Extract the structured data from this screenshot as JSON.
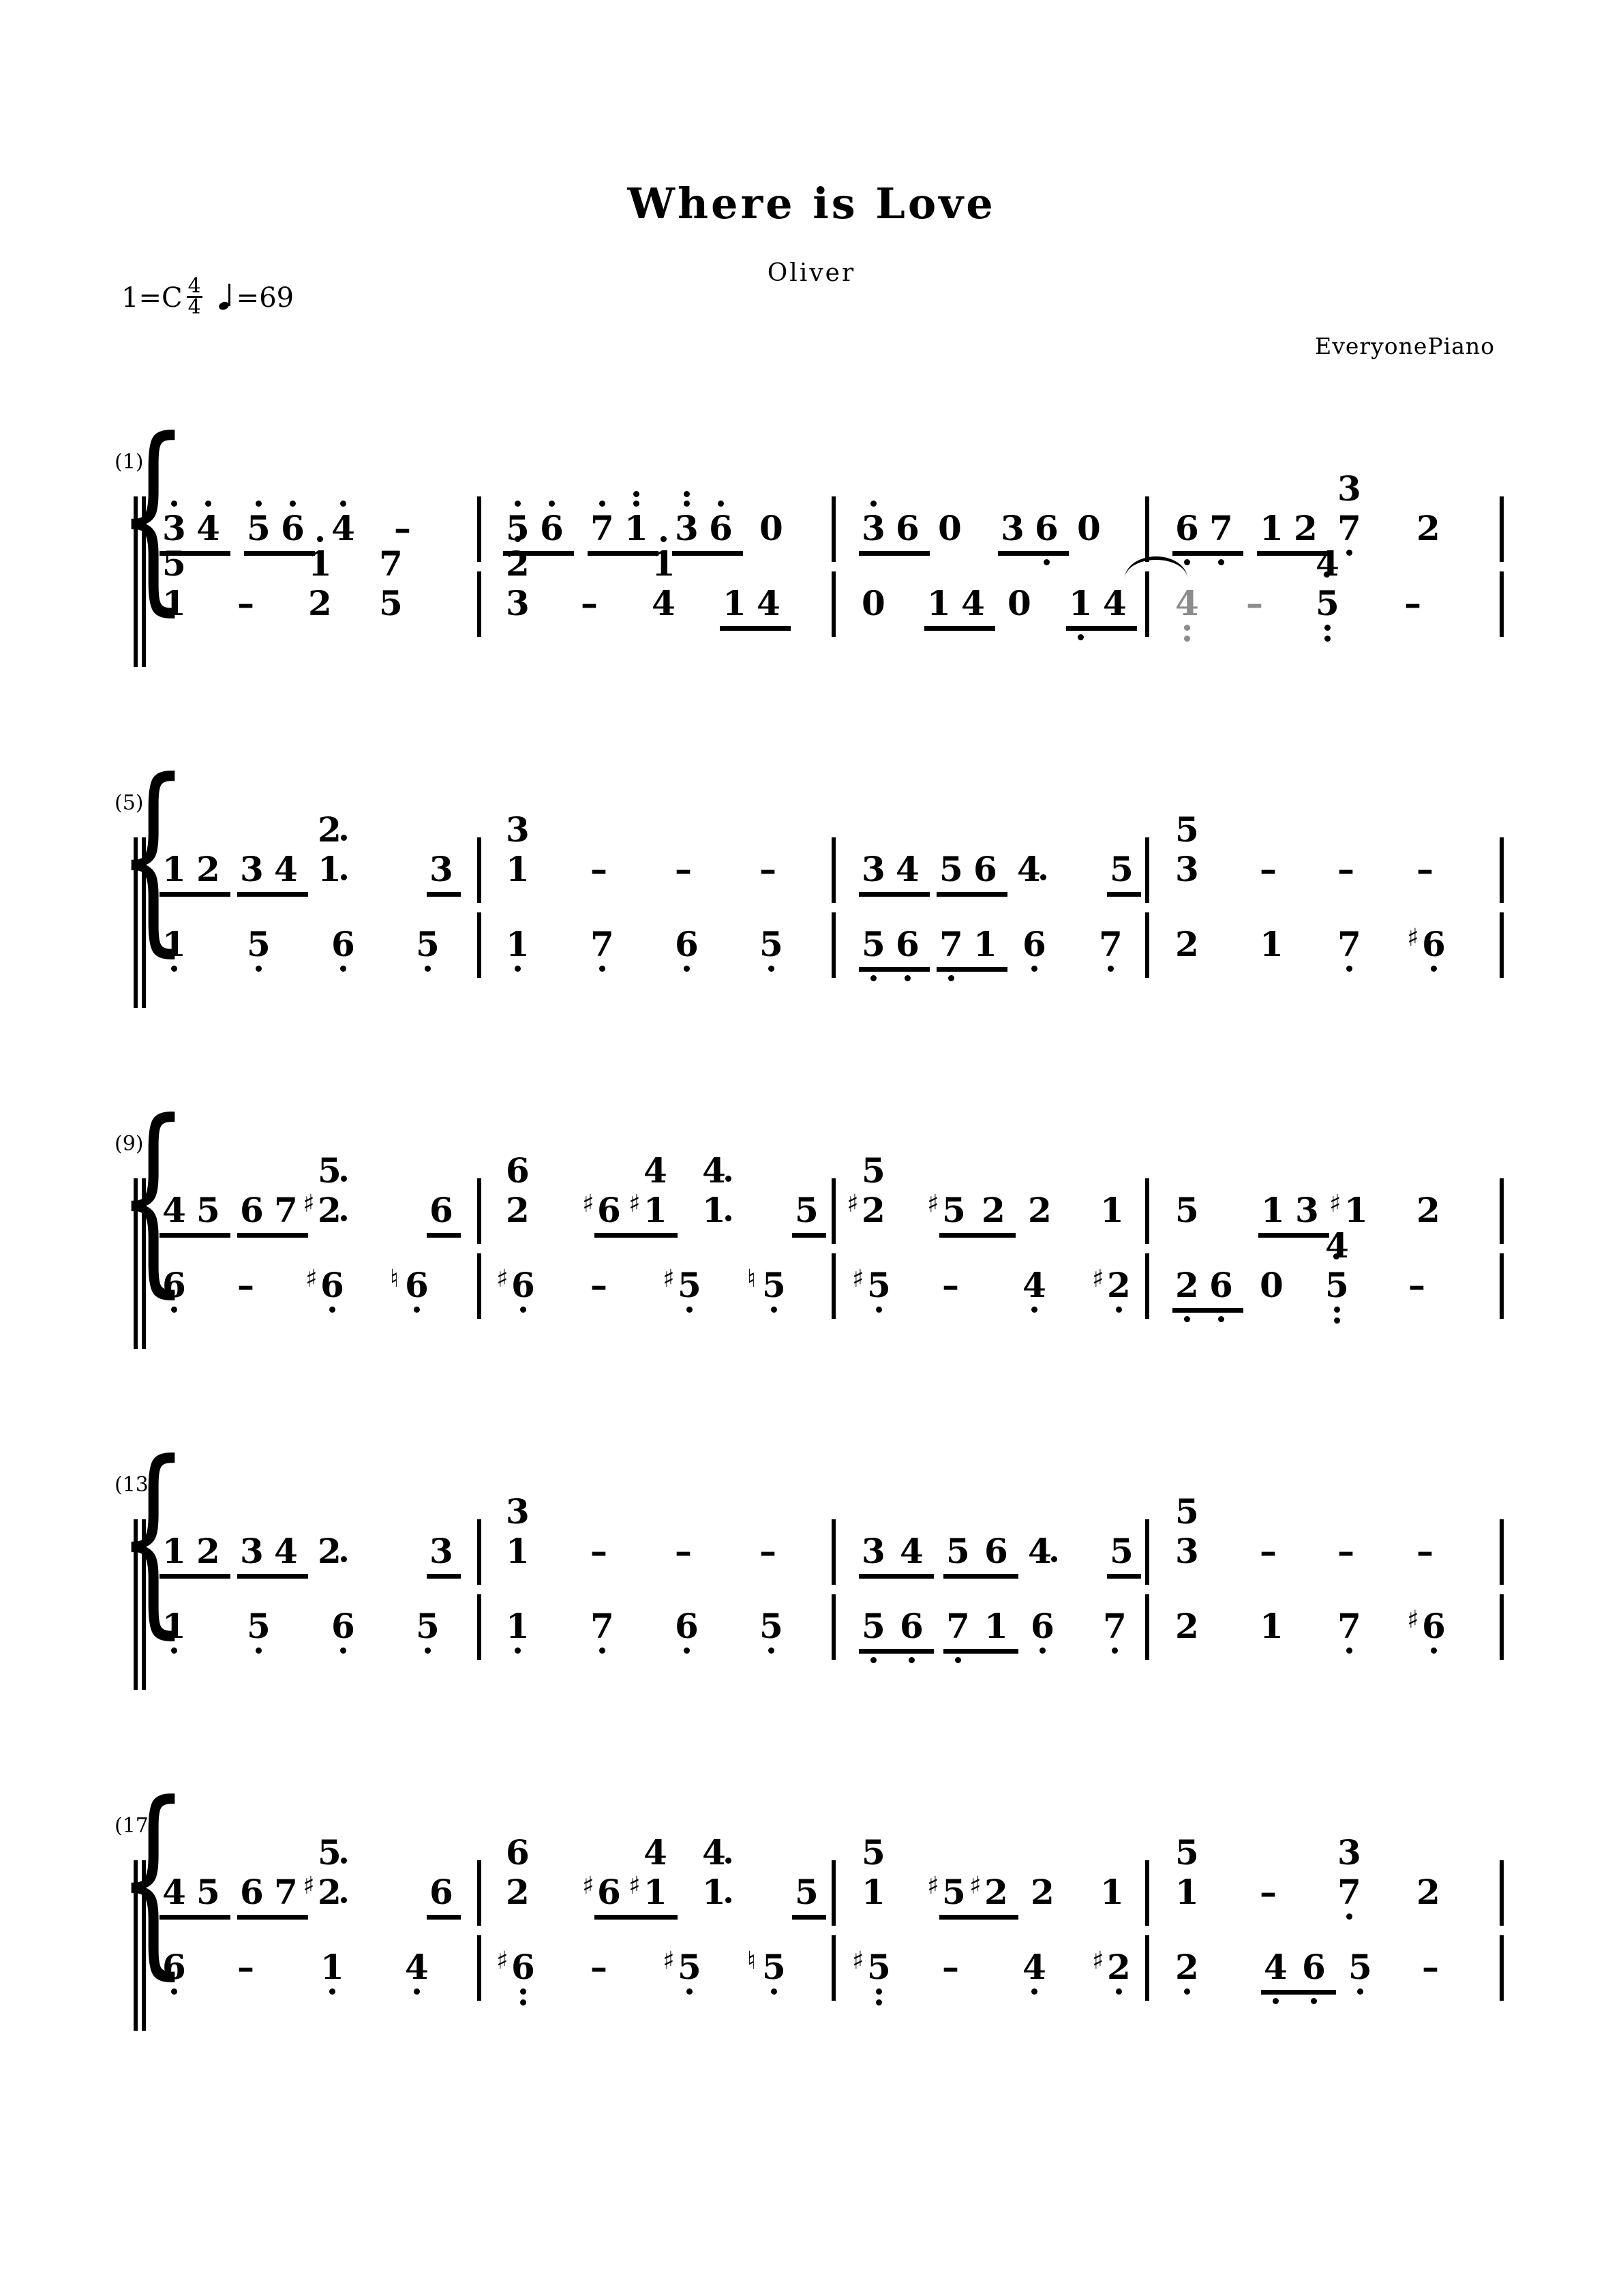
{
  "header": {
    "title": "Where is Love",
    "composer": "Oliver",
    "publisher": "EveryonePiano",
    "key_label": "1=C",
    "time_num": "4",
    "time_den": "4",
    "tempo_eq": "=69",
    "note_icon": "quarter-note-icon"
  },
  "score": {
    "notation": "jianpu",
    "systems": [
      {
        "number": "(1)",
        "measures": [
          "1",
          "2",
          "3",
          "4"
        ]
      },
      {
        "number": "(5)",
        "measures": [
          "5",
          "6",
          "7",
          "8"
        ]
      },
      {
        "number": "(9)",
        "measures": [
          "9",
          "10",
          "11",
          "12"
        ]
      },
      {
        "number": "(13)",
        "measures": [
          "13",
          "14",
          "15",
          "16"
        ]
      },
      {
        "number": "(17)",
        "measures": [
          "17",
          "18",
          "19",
          "20"
        ]
      }
    ],
    "notes": {
      "s1": {
        "treble": [
          "3",
          "4",
          "5",
          "6",
          "4",
          "-",
          "5",
          "6",
          "7",
          "1",
          "3",
          "6",
          "0",
          "3",
          "6",
          "0",
          "3",
          "6",
          "0",
          "6",
          "7",
          "1",
          "2",
          "3",
          "7",
          "2"
        ],
        "bass": [
          "5",
          "1",
          "-",
          "1",
          "2",
          "7",
          "5",
          "2",
          "3",
          "-",
          "1",
          "4",
          "1",
          "4",
          "0",
          "1",
          "4",
          "0",
          "1",
          "4",
          "4",
          "-",
          "4",
          "5",
          "-"
        ]
      },
      "s2": {
        "treble": [
          "1",
          "2",
          "3",
          "4",
          "2",
          "1",
          "3",
          "3",
          "1",
          "-",
          "-",
          "-",
          "3",
          "4",
          "5",
          "6",
          "4",
          "5",
          "5",
          "3",
          "-",
          "-",
          "-"
        ],
        "bass": [
          "1",
          "5",
          "6",
          "5",
          "1",
          "7",
          "6",
          "5",
          "5",
          "6",
          "7",
          "1",
          "6",
          "7",
          "2",
          "1",
          "7",
          "6"
        ]
      },
      "s3": {
        "treble": [
          "4",
          "5",
          "6",
          "7",
          "5",
          "2",
          "6",
          "6",
          "2",
          "6",
          "1",
          "4",
          "4",
          "1",
          "5",
          "5",
          "2",
          "5",
          "2",
          "2",
          "1",
          "5",
          "1",
          "3",
          "1",
          "2"
        ],
        "bass": [
          "6",
          "-",
          "6",
          "6",
          "6",
          "-",
          "5",
          "5",
          "5",
          "-",
          "4",
          "2",
          "2",
          "6",
          "0",
          "4",
          "5",
          "-"
        ]
      },
      "s4": {
        "treble": [
          "1",
          "2",
          "3",
          "4",
          "2",
          "3",
          "3",
          "1",
          "-",
          "-",
          "-",
          "3",
          "4",
          "5",
          "6",
          "4",
          "5",
          "5",
          "3",
          "-",
          "-",
          "-"
        ],
        "bass": [
          "1",
          "5",
          "6",
          "5",
          "1",
          "7",
          "6",
          "5",
          "5",
          "6",
          "7",
          "1",
          "6",
          "7",
          "2",
          "1",
          "7",
          "6"
        ]
      },
      "s5": {
        "treble": [
          "4",
          "5",
          "6",
          "7",
          "5",
          "2",
          "6",
          "6",
          "2",
          "6",
          "1",
          "4",
          "4",
          "1",
          "5",
          "5",
          "1",
          "5",
          "2",
          "2",
          "1",
          "5",
          "1",
          "-",
          "3",
          "7",
          "2"
        ],
        "bass": [
          "6",
          "-",
          "1",
          "4",
          "6",
          "-",
          "5",
          "5",
          "5",
          "-",
          "4",
          "2",
          "2",
          "4",
          "6",
          "5",
          "-"
        ]
      }
    }
  }
}
